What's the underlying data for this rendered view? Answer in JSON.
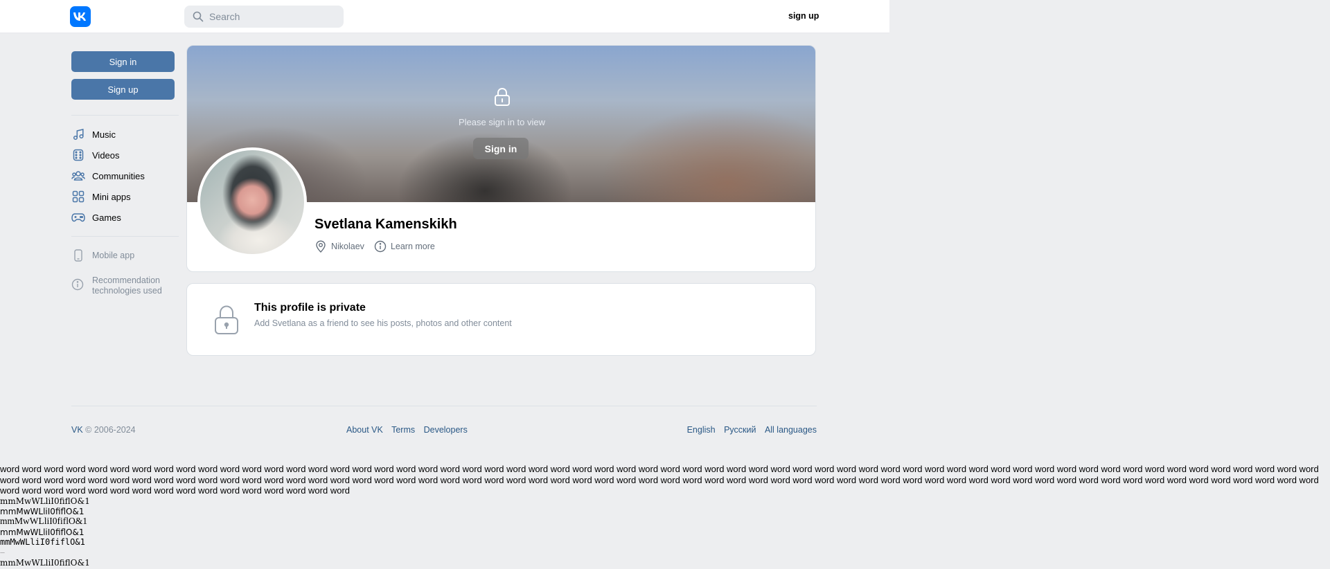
{
  "header": {
    "logo_text": "VK",
    "search_placeholder": "Search",
    "signup_label": "sign up"
  },
  "sidebar": {
    "signin_label": "Sign in",
    "signup_label": "Sign up",
    "items": [
      {
        "label": "Music",
        "icon": "music-icon"
      },
      {
        "label": "Videos",
        "icon": "videos-icon"
      },
      {
        "label": "Communities",
        "icon": "communities-icon"
      },
      {
        "label": "Mini apps",
        "icon": "mini-apps-icon"
      },
      {
        "label": "Games",
        "icon": "games-icon"
      }
    ],
    "mobile_app_label": "Mobile app",
    "recommendation_label": "Recommendation technologies used"
  },
  "profile": {
    "cover_text": "Please sign in to view",
    "cover_signin_label": "Sign in",
    "name": "Svetlana Kamenskikh",
    "location": "Nikolaev",
    "learn_more": "Learn more"
  },
  "private": {
    "title": "This profile is private",
    "subtitle": "Add Svetlana as a friend to see his posts, photos and other content"
  },
  "footer": {
    "brand": "VK",
    "copyright": " © 2006-2024",
    "links_mid": [
      "About VK",
      "Terms",
      "Developers"
    ],
    "links_right": [
      "English",
      "Русский",
      "All languages"
    ]
  },
  "font_test": {
    "words": "word word word word word word word word word word word word word word word word word word word word word word word word word word word word word word word word word word word word word word word word word word word word word word word word word word word word word word word word word word word word word word word word word word word word word word word word word word word word word word word word word word word word word word word word word word word word word word word word word word word word word word word word word word word word word word word word word word word word word word word word word word word word word word word word word word word word word word word word",
    "line": "mmMwWLliI0fiflO&1",
    "line_mono": "mmMwWLliI0fiflO&1",
    "dash": "—"
  },
  "colors": {
    "background": "#edeef0",
    "accent": "#4a76a8",
    "logo": "#0077ff",
    "link": "#2a5885",
    "muted": "#818c99"
  }
}
